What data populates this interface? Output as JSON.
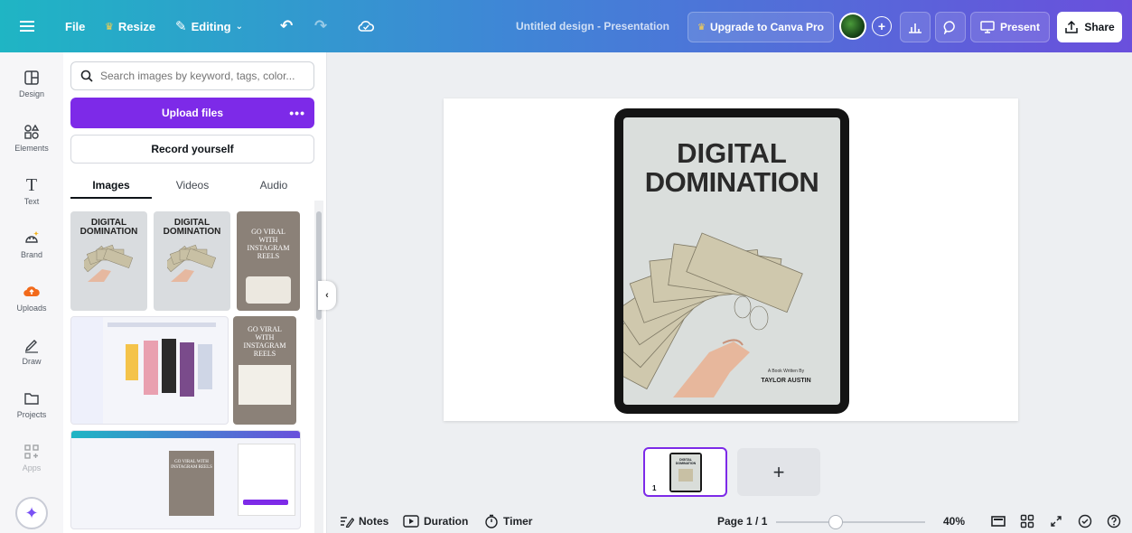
{
  "topbar": {
    "menu_icon": "menu-icon",
    "file_label": "File",
    "resize_label": "Resize",
    "editing_label": "Editing",
    "doc_title": "Untitled design - Presentation",
    "upgrade_label": "Upgrade to Canva Pro",
    "present_label": "Present",
    "share_label": "Share",
    "avatar_plus": "+"
  },
  "rail": {
    "items": [
      {
        "label": "Design",
        "icon": "design-icon"
      },
      {
        "label": "Elements",
        "icon": "elements-icon"
      },
      {
        "label": "Text",
        "icon": "text-icon"
      },
      {
        "label": "Brand",
        "icon": "brand-icon"
      },
      {
        "label": "Uploads",
        "icon": "uploads-icon"
      },
      {
        "label": "Draw",
        "icon": "draw-icon"
      },
      {
        "label": "Projects",
        "icon": "projects-icon"
      },
      {
        "label": "Apps",
        "icon": "apps-icon"
      }
    ],
    "magic_icon": "sparkle-icon"
  },
  "panel": {
    "search_placeholder": "Search images by keyword, tags, color...",
    "upload_label": "Upload files",
    "upload_more": "•••",
    "record_label": "Record yourself",
    "tabs": [
      "Images",
      "Videos",
      "Audio"
    ],
    "thumbs": {
      "cover_line1": "DIGITAL",
      "cover_line2": "DOMINATION",
      "viral_text": "GO VIRAL WITH INSTAGRAM REELS"
    }
  },
  "canvas": {
    "title_line1": "DIGITAL",
    "title_line2": "DOMINATION",
    "byline": "A Book Written By",
    "author": "TAYLOR AUSTIN"
  },
  "pages": {
    "current": "1",
    "add_label": "+"
  },
  "bottombar": {
    "notes_label": "Notes",
    "duration_label": "Duration",
    "timer_label": "Timer",
    "page_label": "Page 1 / 1",
    "zoom_label": "40%",
    "zoom_fraction": 0.4
  },
  "colors": {
    "accent": "#7d2ae8",
    "topbar_start": "#1fb5c4",
    "topbar_end": "#6a4fdc"
  }
}
